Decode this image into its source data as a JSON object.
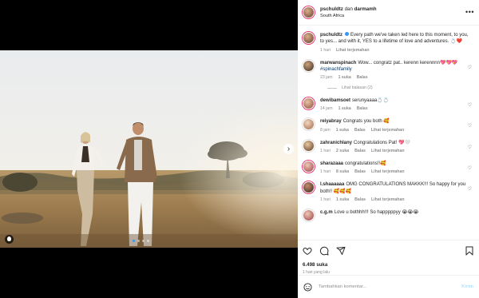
{
  "post": {
    "header": {
      "author": "pschuldtz",
      "connector": " dan ",
      "coauthor": "darmamh",
      "location": "South Africa",
      "more_icon": "more-options-icon"
    },
    "caption": {
      "user": "pschuldtz",
      "text": "Every path we've taken led here to this moment, to you, to yes... and with it, YES to a lifetime of love and adventures. 💍❤️",
      "time": "1 hari",
      "translate": "Lihat terjemahan"
    },
    "comments": [
      {
        "user": "marwanspinach",
        "text": "Wow... congratz pat.. kerenn kerennnn💖💖💖",
        "tag": "#spinachfamily",
        "time": "23 jam",
        "likes": "1 suka",
        "reply": "Balas",
        "translate": "",
        "replies": "Lihat balasan (2)"
      },
      {
        "user": "dewibamsoet",
        "text": "serunyaaaa💍💍",
        "tag": "",
        "time": "14 jam",
        "likes": "1 suka",
        "reply": "Balas",
        "translate": "",
        "replies": ""
      },
      {
        "user": "reiyabray",
        "text": "Congrats you both 🥰",
        "tag": "",
        "time": "8 jam",
        "likes": "1 suka",
        "reply": "Balas",
        "translate": "Lihat terjemahan",
        "replies": ""
      },
      {
        "user": "zahranichlany",
        "text": "Congratulations Pat! 💖🤍",
        "tag": "",
        "time": "1 hari",
        "likes": "2 suka",
        "reply": "Balas",
        "translate": "Lihat terjemahan",
        "replies": ""
      },
      {
        "user": "sharazaaa",
        "text": "congratulations!!🥰",
        "tag": "",
        "time": "1 hari",
        "likes": "8 suka",
        "reply": "Balas",
        "translate": "Lihat terjemahan",
        "replies": ""
      },
      {
        "user": "l.shaaaaaa",
        "text": "OMG CONGRATULATIONS MAKKK!!! So happy for you both!! 🥰🥰🥰",
        "tag": "",
        "time": "1 hari",
        "likes": "1 suka",
        "reply": "Balas",
        "translate": "Lihat terjemahan",
        "replies": ""
      },
      {
        "user": "c.g.m",
        "text": "Love u bothhh!!! So happpppyy 😭😭😭",
        "tag": "",
        "time": "",
        "likes": "",
        "reply": "",
        "translate": "",
        "replies": ""
      }
    ],
    "likes": "6.498 suka",
    "time": "1 hari yang lalu",
    "add_comment": {
      "placeholder": "Tambahkan komentar...",
      "post_label": "Kirim"
    },
    "carousel": {
      "count": 4,
      "active": 1
    }
  },
  "colors": {
    "accent": "#3897f0",
    "heart": "#ed4956",
    "text": "#262626",
    "muted": "#8e8e8e"
  }
}
